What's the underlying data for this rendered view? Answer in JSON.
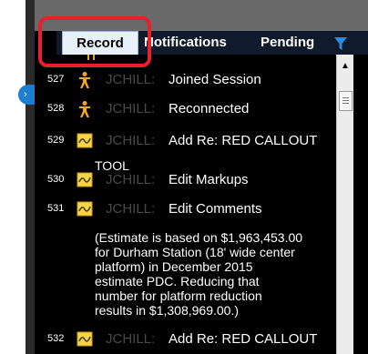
{
  "tabs": {
    "record": "Record",
    "notifications": "Notifications",
    "pending": "Pending"
  },
  "colors": {
    "highlight": "#e8202a",
    "accent": "#1b7fd1",
    "user_text": "#4a4a4a"
  },
  "records": [
    {
      "num": "527",
      "icon": "person-icon",
      "user": "JCHILL:",
      "action": "Joined Session"
    },
    {
      "num": "528",
      "icon": "person-icon",
      "user": "JCHILL:",
      "action": "Reconnected"
    },
    {
      "num": "529",
      "icon": "markup-icon",
      "user": "JCHILL:",
      "action": "Add Re: RED CALLOUT",
      "continuation": "TOOL"
    },
    {
      "num": "530",
      "icon": "markup-icon",
      "user": "JCHILL:",
      "action": "Edit Markups"
    },
    {
      "num": "531",
      "icon": "markup-icon",
      "user": "JCHILL:",
      "action": "Edit Comments",
      "comment_lines": [
        "(Estimate is based on $1,963,453.00",
        "for Durham Station (18' wide center",
        "platform) in December 2015",
        "estimate PDC.  Reducing that",
        "number for platform reduction",
        "results in $1,308,969.00.)"
      ]
    },
    {
      "num": "532",
      "icon": "markup-icon",
      "user": "JCHILL:",
      "action": "Add Re: RED CALLOUT"
    }
  ]
}
